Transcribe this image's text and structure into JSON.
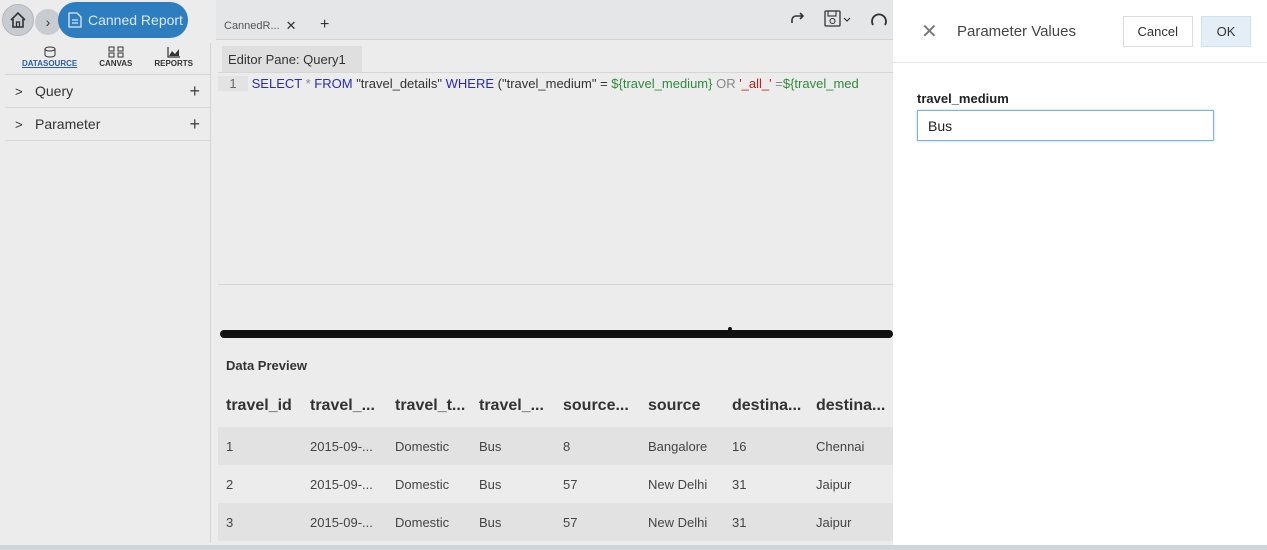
{
  "breadcrumb": {
    "report_label": "Canned Report"
  },
  "side_panel": {
    "tabs": [
      {
        "label": "DATASOURCE",
        "icon": "datasource-icon",
        "active": true
      },
      {
        "label": "CANVAS",
        "icon": "canvas-icon",
        "active": false
      },
      {
        "label": "REPORTS",
        "icon": "reports-chart-icon",
        "active": false
      }
    ],
    "tree": [
      {
        "label": "Query"
      },
      {
        "label": "Parameter"
      }
    ]
  },
  "tabs_bar": {
    "doc_tab_label": "CannedR...",
    "add_tab": "+"
  },
  "editor": {
    "pane_title": "Editor Pane: Query1",
    "line_number": "1",
    "query_parts": {
      "kw1": "SELECT",
      "star": "*",
      "kw2": "FROM",
      "table": "\"travel_details\"",
      "kw3": "WHERE",
      "cond": "(\"travel_medium\" = ",
      "param1": "${travel_medium}",
      "or": " OR ",
      "all": "'_all_'",
      "eq": " =",
      "param2": "${travel_med"
    }
  },
  "preview": {
    "title": "Data Preview",
    "columns": [
      "travel_id",
      "travel_...",
      "travel_t...",
      "travel_...",
      "source...",
      "source",
      "destina...",
      "destina..."
    ],
    "rows": [
      [
        "1",
        "2015-09-...",
        "Domestic",
        "Bus",
        "8",
        "Bangalore",
        "16",
        "Chennai"
      ],
      [
        "2",
        "2015-09-...",
        "Domestic",
        "Bus",
        "57",
        "New Delhi",
        "31",
        "Jaipur"
      ],
      [
        "3",
        "2015-09-...",
        "Domestic",
        "Bus",
        "57",
        "New Delhi",
        "31",
        "Jaipur"
      ]
    ]
  },
  "modal": {
    "title": "Parameter Values",
    "cancel_label": "Cancel",
    "ok_label": "OK",
    "field_label": "travel_medium",
    "field_value": "Bus"
  },
  "colors": {
    "accent": "#2d7dbf",
    "keyword": "#2b2bb0",
    "param": "#2e8b3a",
    "string_red": "#c02020"
  }
}
